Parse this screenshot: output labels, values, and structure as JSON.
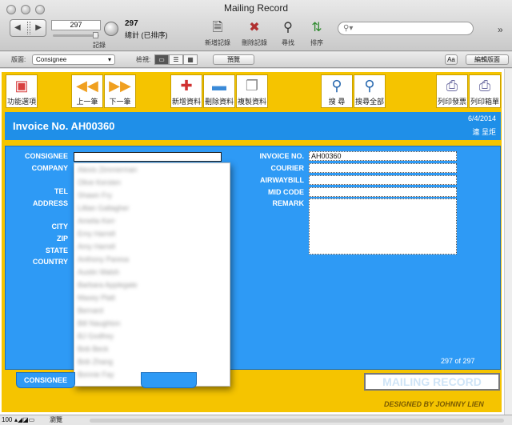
{
  "window": {
    "title": "Mailing Record"
  },
  "toolbar": {
    "record_value": "297",
    "record_label": "記錄",
    "total_count": "297",
    "total_label": "總計 (已排序)",
    "new_record": "新增記錄",
    "delete_record": "刪除記錄",
    "find": "尋找",
    "sort": "排序"
  },
  "layoutbar": {
    "layout_label": "版面:",
    "layout_value": "Consignee",
    "view_label": "檢視:",
    "preview": "預覽",
    "aa": "Aa",
    "edit_layout": "編輯版面"
  },
  "nav": [
    {
      "label": "功能選項",
      "icon": "folder-icon"
    },
    {
      "label": "上一筆",
      "icon": "prev-arrow-icon"
    },
    {
      "label": "下一筆",
      "icon": "next-arrow-icon"
    },
    {
      "label": "新增資料",
      "icon": "new-doc-icon"
    },
    {
      "label": "刪除資料",
      "icon": "delete-doc-icon"
    },
    {
      "label": "複製資料",
      "icon": "copy-doc-icon"
    },
    {
      "label": "搜 尋",
      "icon": "magnifier-icon"
    },
    {
      "label": "搜尋全部",
      "icon": "magnifier-all-icon"
    },
    {
      "label": "列印發票",
      "icon": "printer-icon"
    },
    {
      "label": "列印箱單",
      "icon": "printer-icon"
    }
  ],
  "header": {
    "invoice_title": "Invoice No. AH00360",
    "date": "6/4/2014",
    "employee": "連 呈炬"
  },
  "form": {
    "left_labels": [
      "CONSIGNEE",
      "COMPANY",
      "TEL",
      "ADDRESS",
      "CITY",
      "ZIP",
      "STATE",
      "COUNTRY"
    ],
    "right_labels": [
      "INVOICE NO.",
      "COURIER",
      "AIRWAYBILL",
      "MID CODE",
      "REMARK"
    ],
    "invoice_no": "AH00360"
  },
  "dropdown": {
    "items": [
      "Alexis Zimmerman",
      "Olive Kersten",
      "Shawn Fry",
      "Lillian Gallagher",
      "Amelia Kerr",
      "Emy Harrell",
      "Amy Harrell",
      "Anthony Paresa",
      "Austin Walsh",
      "Barbara Applegate",
      "Maxey Platt",
      "Bernard",
      "Bill Naughton",
      "BJ Godfrey",
      "Bob Beck",
      "Bob Zhang",
      "Bonnie Fay"
    ]
  },
  "footer": {
    "record_count": "297 of 297",
    "tab_label": "CONSIGNEE",
    "brand": "MAILING RECORD",
    "designed_by": "DESIGNED BY JOHNNY LIEN"
  },
  "status": {
    "zoom": "100",
    "mode": "瀏覽"
  }
}
